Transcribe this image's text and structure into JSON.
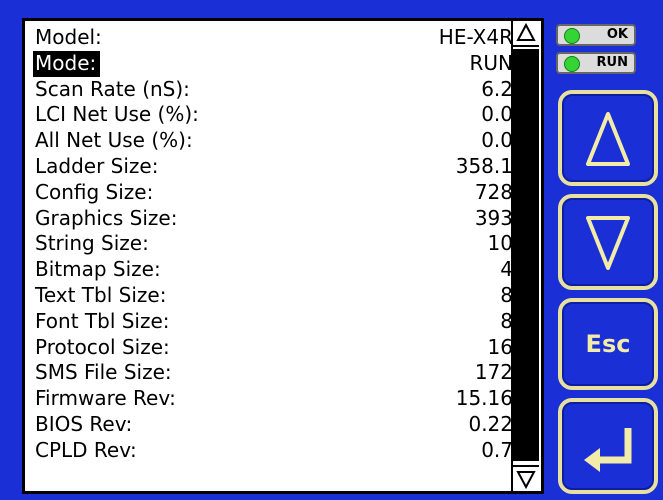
{
  "status": {
    "ok_label": "OK",
    "run_label": "RUN"
  },
  "keys": {
    "esc_label": "Esc"
  },
  "info_rows": [
    {
      "label": "Model:",
      "value": "HE-X4R"
    },
    {
      "label": "Mode:",
      "value": "RUN"
    },
    {
      "label": "Scan Rate (nS):",
      "value": "6.2"
    },
    {
      "label": "LCI Net Use (%):",
      "value": "0.0"
    },
    {
      "label": "All Net Use (%):",
      "value": "0.0"
    },
    {
      "label": "Ladder Size:",
      "value": "358.1"
    },
    {
      "label": "Config Size:",
      "value": "728"
    },
    {
      "label": "Graphics Size:",
      "value": "393"
    },
    {
      "label": "String Size:",
      "value": "10"
    },
    {
      "label": "Bitmap Size:",
      "value": "4"
    },
    {
      "label": "Text Tbl Size:",
      "value": "8"
    },
    {
      "label": "Font Tbl Size:",
      "value": "8"
    },
    {
      "label": "Protocol Size:",
      "value": "16"
    },
    {
      "label": "SMS File Size:",
      "value": "172"
    },
    {
      "label": "Firmware Rev:",
      "value": "15.16"
    },
    {
      "label": "BIOS Rev:",
      "value": "0.22"
    },
    {
      "label": "CPLD Rev:",
      "value": "0.7"
    }
  ],
  "selected_row": "Mode:",
  "colors": {
    "bezel": "#1a2fd6",
    "key_border": "#e8e0a0",
    "led_green": "#35d435"
  },
  "icons": {
    "scroll_up": "up-triangle-icon",
    "scroll_down": "down-triangle-icon",
    "key_up": "up-arrow-icon",
    "key_down": "down-arrow-icon",
    "key_enter": "enter-arrow-icon"
  }
}
